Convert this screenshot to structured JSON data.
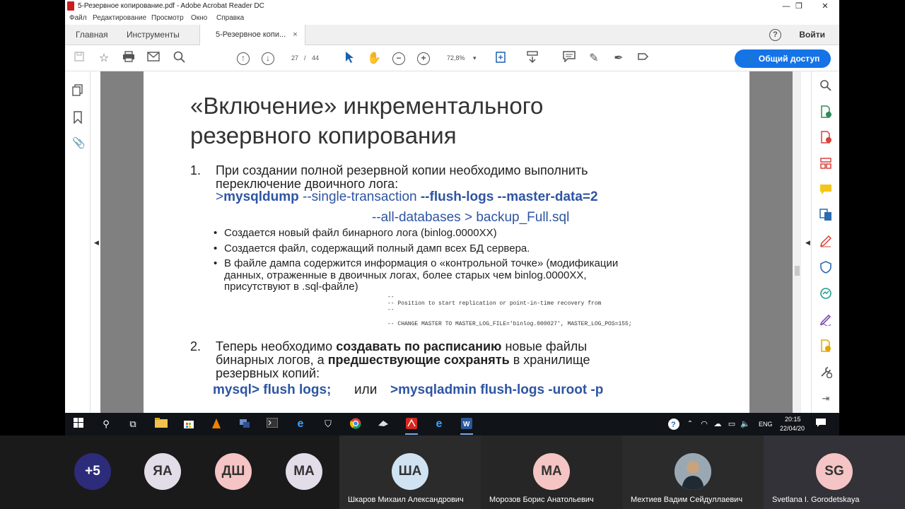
{
  "window": {
    "title": "5-Резервное копирование.pdf - Adobe Acrobat Reader DC",
    "min_glyph": "—",
    "restore_glyph": "❐",
    "close_glyph": "✕"
  },
  "menu": [
    "Файл",
    "Редактирование",
    "Просмотр",
    "Окно",
    "Справка"
  ],
  "tabs": {
    "home": "Главная",
    "tools": "Инструменты",
    "document": "5-Резервное копи...",
    "close": "×",
    "help": "?",
    "login": "Войти"
  },
  "toolbar": {
    "page_current": "27",
    "page_sep": "/",
    "page_total": "44",
    "zoom": "72,8%",
    "zoom_arrow": "▾",
    "share": "Общий доступ"
  },
  "slide": {
    "title_line1": "«Включение» инкрементального",
    "title_line2": "резервного копирования",
    "item1_num": "1.",
    "item1_line1": "При создании полной резервной копии необходимо выполнить",
    "item1_line2": "переключение двоичного лога:",
    "cmd1_prefix": ">",
    "cmd1_mysqldump": "mysqldump",
    "cmd1_single": " --single-transaction ",
    "cmd1_flags": "--flush-logs --master-data=2",
    "cmd1_line2": "--all-databases > backup_Full.sql",
    "bullets": [
      "Создается новый файл бинарного лога (binlog.0000XX)",
      "Создается файл, содержащий полный дамп всех БД сервера.",
      "В файле дампа содержится информация о «контрольной точке» (модификации",
      "данных, отраженные в двоичных логах, более старых чем binlog.0000XX,",
      "присутствуют в .sql-файле)"
    ],
    "code_lines": [
      "--",
      "-- Position to start replication or point-in-time recovery from",
      "--",
      "",
      "-- CHANGE MASTER TO MASTER_LOG_FILE='binlog.000027', MASTER_LOG_POS=155;"
    ],
    "item2_num": "2.",
    "item2_a": "Теперь необходимо ",
    "item2_b": "создавать по расписанию",
    "item2_c": " новые файлы",
    "item2_d": "бинарных логов, а ",
    "item2_e": "предшествующие сохранять",
    "item2_f": " в хранилище",
    "item2_g": "резервных копий:",
    "cmd2_a": "mysql> flush logs;",
    "cmd2_or": "или",
    "cmd2_b": ">mysqladmin flush-logs -uroot -p"
  },
  "taskbar": {
    "lang": "ENG",
    "time": "20:15",
    "date": "22/04/20"
  },
  "participants": [
    {
      "initials": "+5",
      "name": "",
      "color": "#2d2c7a",
      "text": "#ffffff"
    },
    {
      "initials": "ЯА",
      "name": "",
      "color": "#e2dde9",
      "text": "#333333"
    },
    {
      "initials": "ДШ",
      "name": "",
      "color": "#f5c4c4",
      "text": "#333333"
    },
    {
      "initials": "МА",
      "name": "",
      "color": "#e2dde9",
      "text": "#333333"
    },
    {
      "initials": "ША",
      "name": "Шкаров Михаил Александрович",
      "color": "#cfe3f3",
      "text": "#333333"
    },
    {
      "initials": "МА",
      "name": "Морозов Борис Анатольевич",
      "color": "#f5c4c4",
      "text": "#333333"
    },
    {
      "initials": "",
      "name": "Мехтиев Вадим Сейдуллаевич",
      "color": "#7a8a95",
      "text": "#ffffff"
    },
    {
      "initials": "SG",
      "name": "Svetlana I. Gorodetskaya",
      "color": "#f5c4c4",
      "text": "#333333"
    }
  ]
}
